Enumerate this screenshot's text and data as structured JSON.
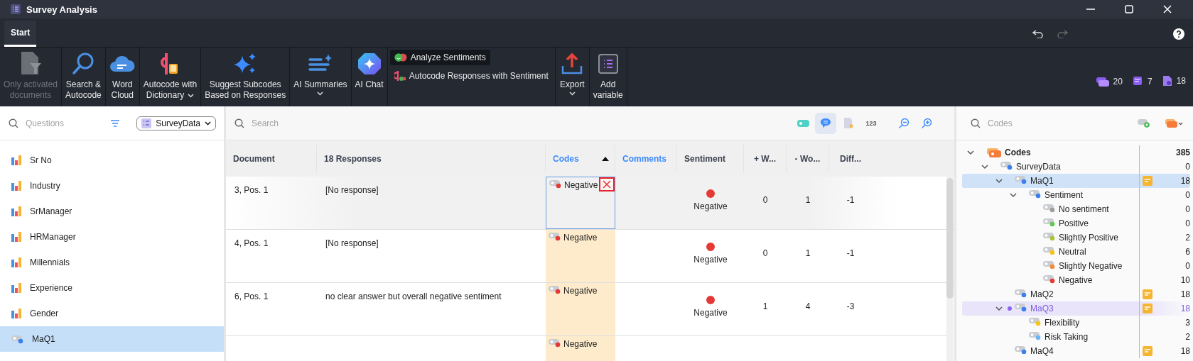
{
  "window": {
    "title": "Survey Analysis"
  },
  "tabs": [
    {
      "label": "Start",
      "selected": true
    }
  ],
  "ribbon": {
    "items": [
      {
        "kind": "button",
        "label": "Only activated\ndocuments",
        "disabled": true
      },
      {
        "kind": "button",
        "label": "Search &\nAutocode",
        "disabled": false
      },
      {
        "kind": "button",
        "label": "Word\nCloud",
        "disabled": false
      },
      {
        "kind": "split",
        "label": "Autocode with\nDictionary",
        "disabled": false
      },
      {
        "kind": "button",
        "label": "Suggest Subcodes\nBased on Responses",
        "disabled": false
      },
      {
        "kind": "menu",
        "label": "AI Summaries",
        "disabled": false
      },
      {
        "kind": "button",
        "label": "AI Chat",
        "disabled": false
      },
      {
        "kind": "stack",
        "items": [
          {
            "label": "Analyze Sentiments",
            "selected": true
          },
          {
            "label": "Autocode Responses with Sentiment",
            "selected": false
          }
        ]
      },
      {
        "kind": "menu",
        "label": "Export",
        "disabled": false
      },
      {
        "kind": "button",
        "label": "Add\nvariable",
        "disabled": false
      }
    ],
    "counters": [
      {
        "value": "20"
      },
      {
        "value": "7"
      },
      {
        "value": "18"
      }
    ]
  },
  "questions": {
    "placeholder": "Questions",
    "dataset": "SurveyData",
    "items": [
      {
        "kind": "variable",
        "label": "Sr No",
        "selected": false
      },
      {
        "kind": "variable",
        "label": "Industry",
        "selected": false
      },
      {
        "kind": "variable",
        "label": "SrManager",
        "selected": false
      },
      {
        "kind": "variable",
        "label": "HRManager",
        "selected": false
      },
      {
        "kind": "variable",
        "label": "Millennials",
        "selected": false
      },
      {
        "kind": "variable",
        "label": "Experience",
        "selected": false
      },
      {
        "kind": "variable",
        "label": "Gender",
        "selected": false
      },
      {
        "kind": "code",
        "label": "MaQ1",
        "selected": true
      }
    ]
  },
  "responses": {
    "placeholder": "Search",
    "tools": [
      {
        "kind": "code-toggle",
        "selected": false
      },
      {
        "kind": "comment",
        "selected": true
      },
      {
        "kind": "doc-star",
        "selected": false
      },
      {
        "kind": "text",
        "label": "123",
        "selected": false
      },
      {
        "kind": "zoom-out",
        "selected": false
      },
      {
        "kind": "zoom-in",
        "selected": false
      }
    ],
    "columns": [
      {
        "label": "Document",
        "linked": false,
        "sorted": false
      },
      {
        "label": "18 Responses",
        "linked": false,
        "sorted": false
      },
      {
        "label": "Codes",
        "linked": true,
        "sorted": true
      },
      {
        "label": "Comments",
        "linked": true,
        "sorted": false
      },
      {
        "label": "Sentiment",
        "linked": false,
        "sorted": false
      },
      {
        "label": "+ W...",
        "linked": false,
        "sorted": false
      },
      {
        "label": "- Wo...",
        "linked": false,
        "sorted": false
      },
      {
        "label": "Diff...",
        "linked": false,
        "sorted": false
      }
    ],
    "rows": [
      {
        "document": "3, Pos. 1",
        "response": "[No response]",
        "codes": [
          {
            "label": "Negative",
            "color": "#e53935"
          }
        ],
        "sentiment": {
          "label": "Negative",
          "color": "#e53935"
        },
        "positive_words": "0",
        "negative_words": "1",
        "difference": "-1",
        "selected": true
      },
      {
        "document": "4, Pos. 1",
        "response": "[No response]",
        "codes": [
          {
            "label": "Negative",
            "color": "#e53935"
          }
        ],
        "sentiment": {
          "label": "Negative",
          "color": "#e53935"
        },
        "positive_words": "0",
        "negative_words": "1",
        "difference": "-1",
        "selected": false
      },
      {
        "document": "6, Pos. 1",
        "response": "no clear answer but overall negative sentiment",
        "codes": [
          {
            "label": "Negative",
            "color": "#e53935"
          }
        ],
        "sentiment": {
          "label": "Negative",
          "color": "#e53935"
        },
        "positive_words": "1",
        "negative_words": "4",
        "difference": "-3",
        "selected": false
      },
      {
        "codes": [
          {
            "label": "Negative",
            "color": "#e53935"
          }
        ],
        "selected": false
      }
    ]
  },
  "codes": {
    "placeholder": "Codes",
    "tree": [
      {
        "kind": "set",
        "label": "Codes",
        "count": "385",
        "expanded": true,
        "selected": false,
        "activated": false,
        "memo": false,
        "children": [
          {
            "kind": "code",
            "label": "SurveyData",
            "count": "0",
            "color": "#3b7ff0",
            "expanded": true,
            "selected": false,
            "activated": false,
            "memo": false,
            "children": [
              {
                "kind": "code",
                "label": "MaQ1",
                "count": "18",
                "color": "#3b7ff0",
                "expanded": true,
                "selected": true,
                "activated": false,
                "memo": true,
                "children": [
                  {
                    "kind": "code",
                    "label": "Sentiment",
                    "count": "0",
                    "color": "#3b7ff0",
                    "expanded": true,
                    "selected": false,
                    "activated": false,
                    "memo": false,
                    "children": [
                      {
                        "kind": "code",
                        "label": "No sentiment",
                        "count": "0",
                        "color": "#9e9e9e",
                        "selected": false,
                        "activated": false,
                        "memo": false
                      },
                      {
                        "kind": "code",
                        "label": "Positive",
                        "count": "0",
                        "color": "#5cc94a",
                        "selected": false,
                        "activated": false,
                        "memo": false
                      },
                      {
                        "kind": "code",
                        "label": "Slightly Positive",
                        "count": "2",
                        "color": "#a8c23a",
                        "selected": false,
                        "activated": false,
                        "memo": false
                      },
                      {
                        "kind": "code",
                        "label": "Neutral",
                        "count": "6",
                        "color": "#f2c31c",
                        "selected": false,
                        "activated": false,
                        "memo": false
                      },
                      {
                        "kind": "code",
                        "label": "Slightly Negative",
                        "count": "0",
                        "color": "#f08a3c",
                        "selected": false,
                        "activated": false,
                        "memo": false
                      },
                      {
                        "kind": "code",
                        "label": "Negative",
                        "count": "10",
                        "color": "#e53935",
                        "selected": false,
                        "activated": false,
                        "memo": false
                      }
                    ]
                  }
                ]
              },
              {
                "kind": "code",
                "label": "MaQ2",
                "count": "18",
                "color": "#3b7ff0",
                "selected": false,
                "activated": false,
                "memo": true
              },
              {
                "kind": "code",
                "label": "MaQ3",
                "count": "18",
                "color": "#3b7ff0",
                "expanded": true,
                "selected": false,
                "activated": true,
                "memo": true,
                "children": [
                  {
                    "kind": "code",
                    "label": "Flexibility",
                    "count": "3",
                    "color": "#f5c518",
                    "selected": false,
                    "activated": false,
                    "memo": false
                  },
                  {
                    "kind": "code",
                    "label": "Risk Taking",
                    "count": "2",
                    "color": "#6cb4f5",
                    "selected": false,
                    "activated": false,
                    "memo": false
                  }
                ]
              },
              {
                "kind": "code",
                "label": "MaQ4",
                "count": "18",
                "color": "#3b7ff0",
                "selected": false,
                "activated": false,
                "memo": true
              }
            ]
          }
        ]
      }
    ]
  }
}
